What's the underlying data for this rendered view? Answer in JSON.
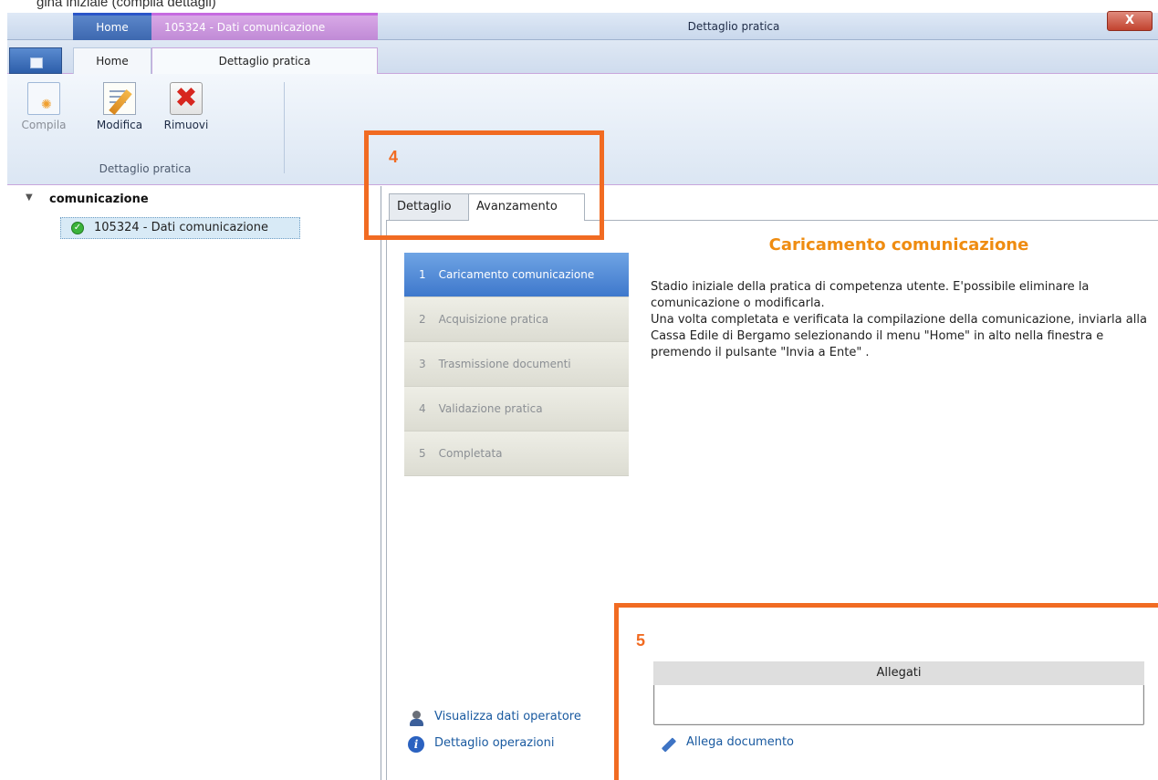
{
  "caption_fragment": "gina iniziale (compila dettagli)",
  "window": {
    "context_tab_home": "Home",
    "context_tab_title": "105324 - Dati comunicazione",
    "title": "Dettaglio pratica",
    "close_label": "X"
  },
  "ribbon_tabs": {
    "home": "Home",
    "dettaglio": "Dettaglio pratica"
  },
  "ribbon": {
    "compila": "Compila",
    "modifica": "Modifica",
    "rimuovi": "Rimuovi",
    "group_label": "Dettaglio pratica"
  },
  "tree": {
    "root": "comunicazione",
    "node": "105324 - Dati comunicazione"
  },
  "detail_tabs": {
    "dettaglio": "Dettaglio",
    "avanzamento": "Avanzamento"
  },
  "steps": [
    {
      "n": "1",
      "label": "Caricamento comunicazione"
    },
    {
      "n": "2",
      "label": "Acquisizione pratica"
    },
    {
      "n": "3",
      "label": "Trasmissione documenti"
    },
    {
      "n": "4",
      "label": "Validazione pratica"
    },
    {
      "n": "5",
      "label": "Completata"
    }
  ],
  "content": {
    "title": "Caricamento comunicazione",
    "description": "Stadio iniziale della pratica di competenza utente. E'possibile eliminare la comunicazione o modificarla.\nUna volta completata e verificata la compilazione della comunicazione, inviarla alla Cassa Edile di Bergamo selezionando il menu \"Home\" in alto nella finestra e premendo il pulsante \"Invia a Ente\" ."
  },
  "links": {
    "operatore": "Visualizza dati operatore",
    "operazioni": "Dettaglio operazioni"
  },
  "attachments": {
    "header": "Allegati",
    "add_link": "Allega documento"
  },
  "annotations": {
    "box4": "4",
    "box5": "5"
  },
  "colors": {
    "highlight": "#f16b22",
    "title_orange": "#ef8c11",
    "active_step": "#3e78cc"
  }
}
